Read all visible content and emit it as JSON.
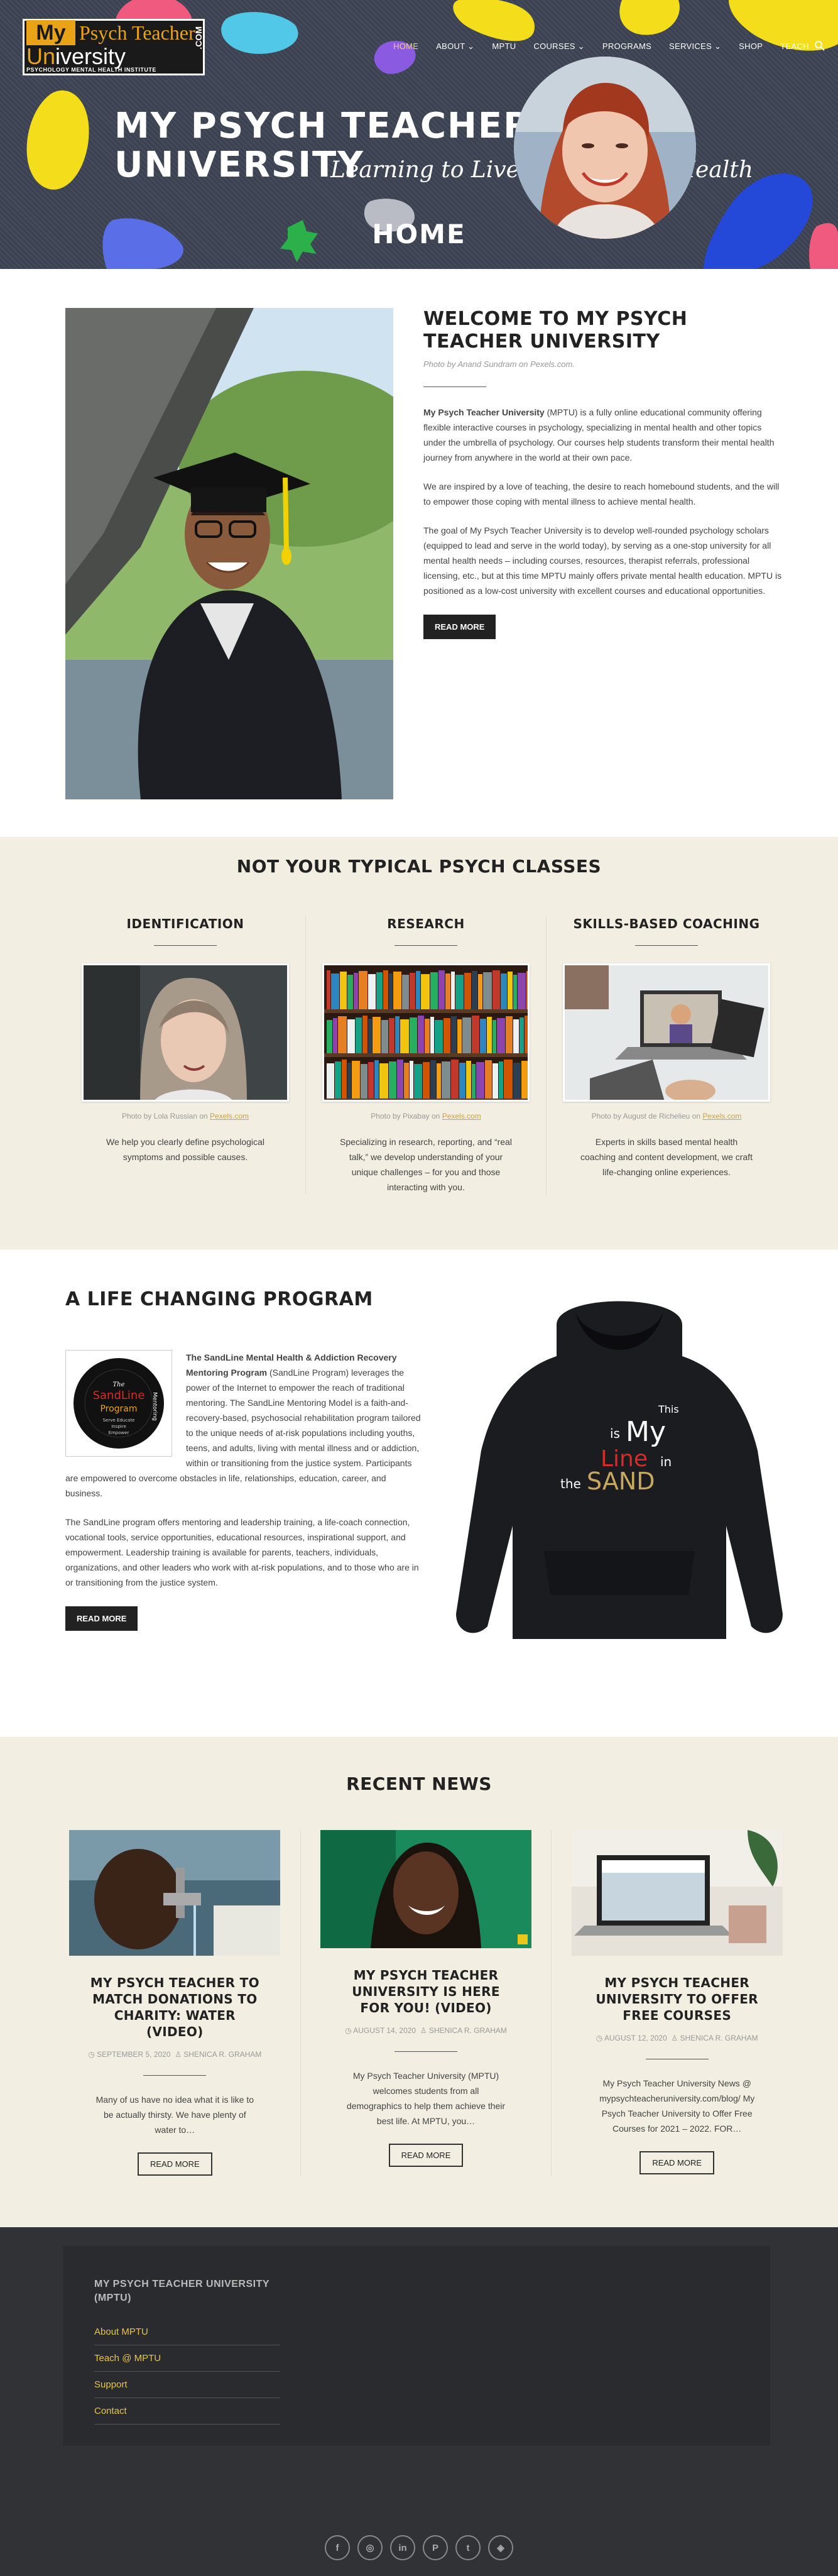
{
  "header": {
    "logo": {
      "my": "My",
      "psych_teacher": "Psych Teacher",
      "university_u": "Un",
      "university_rest": "iversity",
      "subtitle": "PSYCHOLOGY MENTAL HEALTH INSTITUTE",
      "dotcom": ".COM"
    },
    "nav": [
      {
        "label": "HOME",
        "active": true
      },
      {
        "label": "ABOUT ⌄",
        "active": false
      },
      {
        "label": "MPTU",
        "active": false
      },
      {
        "label": "COURSES ⌄",
        "active": false
      },
      {
        "label": "PROGRAMS",
        "active": false
      },
      {
        "label": "SERVICES ⌄",
        "active": false
      },
      {
        "label": "SHOP",
        "active": false
      },
      {
        "label": "TEACH",
        "active": false
      }
    ],
    "hero_title_line1": "MY PSYCH TEACHER",
    "hero_title_line2": "UNIVERSITY",
    "hero_tagline": "Learning to Live With Mental Health",
    "page_title": "HOME"
  },
  "welcome": {
    "title": "WELCOME TO MY PSYCH TEACHER UNIVERSITY",
    "credit_prefix": "Photo by Anand Sundram on ",
    "credit_link": "Pexels.com",
    "credit_suffix": ".",
    "p1_strong": "My Psych Teacher University",
    "p1_rest": " (MPTU) is a fully online educational community offering flexible interactive courses in psychology, specializing in mental health and other topics under the umbrella of psychology. Our courses help students transform their mental health journey from anywhere in the world at their own pace.",
    "p2": "We are inspired by a love of teaching, the desire to reach homebound students, and the will to empower those coping with mental illness to achieve mental health.",
    "p3": "The goal of My Psych Teacher University is to develop well-rounded psychology scholars (equipped to lead and serve in the world today), by serving as a one-stop university for all mental health needs – including courses, resources, therapist referrals, professional licensing, etc., but at this time MPTU mainly offers private mental health education. MPTU is positioned as a low-cost university with excellent courses and educational opportunities.",
    "button": "READ MORE"
  },
  "typical": {
    "title": "NOT YOUR TYPICAL PSYCH CLASSES",
    "columns": [
      {
        "title": "IDENTIFICATION",
        "credit_prefix": "Photo by Lola Russian on ",
        "credit_link": "Pexels.com",
        "text": "We help you clearly define psychological symptoms and possible causes."
      },
      {
        "title": "RESEARCH",
        "credit_prefix": "Photo by Pixabay on ",
        "credit_link": "Pexels.com",
        "text": "Specializing in research, reporting, and “real talk,” we develop understanding of your unique challenges – for you and those interacting with you."
      },
      {
        "title": "SKILLS-BASED COACHING",
        "credit_prefix": "Photo by August de Richelieu on ",
        "credit_link": "Pexels.com",
        "text": "Experts in skills based mental health coaching and content development, we craft life-changing online experiences."
      }
    ]
  },
  "program": {
    "title": "A LIFE CHANGING PROGRAM",
    "logo_the": "The",
    "logo_sandline": "SandLine",
    "logo_program": "Program",
    "logo_tag1": "Serve Educate",
    "logo_tag2": "Inspire",
    "logo_tag3": "Empower",
    "logo_ring": "Mentoring",
    "p1_strong": "The SandLine Mental Health & Addiction Recovery Mentoring Program",
    "p1_rest": " (SandLine Program) leverages the power of the Internet to empower the reach of traditional mentoring. The SandLine Mentoring Model is a faith-and-recovery-based, psychosocial rehabilitation program tailored to the unique needs of at-risk populations including youths, teens, and adults, living with mental illness and or addiction, within or transitioning from the justice system. Participants are empowered to overcome obstacles in life, relationships, education, career, and business.",
    "p2": "The SandLine program offers mentoring and leadership training, a life-coach connection, vocational tools, service opportunities, educational resources, inspirational support, and empowerment. Leadership training is available for parents, teachers, individuals, organizations, and other leaders who work with at-risk populations, and to those who are in or transitioning from the justice system.",
    "button": "READ MORE",
    "hoodie_this": "This",
    "hoodie_is": "is",
    "hoodie_my": "My",
    "hoodie_line": "Line",
    "hoodie_in": "in",
    "hoodie_the": "the",
    "hoodie_sand": "SAND"
  },
  "news": {
    "title": "RECENT NEWS",
    "posts": [
      {
        "title": "MY PSYCH TEACHER TO MATCH DONATIONS TO CHARITY: WATER (VIDEO)",
        "date": "SEPTEMBER 5, 2020",
        "author": "SHENICA R. GRAHAM",
        "excerpt": "Many of us have no idea what it is like to be actually thirsty. We have plenty of water to…",
        "button": "READ MORE"
      },
      {
        "title": "MY PSYCH TEACHER UNIVERSITY IS HERE FOR YOU! (VIDEO)",
        "date": "AUGUST 14, 2020",
        "author": "SHENICA R. GRAHAM",
        "excerpt": "My Psych Teacher University (MPTU) welcomes students from all demographics to help them achieve their best life. At MPTU, you…",
        "button": "READ MORE"
      },
      {
        "title": "MY PSYCH TEACHER UNIVERSITY TO OFFER FREE COURSES",
        "date": "AUGUST 12, 2020",
        "author": "SHENICA R. GRAHAM",
        "excerpt": "My Psych Teacher University News @ mypsychteacheruniversity.com/blog/ My Psych Teacher University to Offer Free Courses for 2021 – 2022. FOR…",
        "button": "READ MORE"
      }
    ]
  },
  "footer": {
    "title": "MY PSYCH TEACHER UNIVERSITY (MPTU)",
    "links": [
      "About MPTU",
      "Teach @ MPTU",
      "Support",
      "Contact"
    ],
    "socials": [
      {
        "icon": "facebook-icon",
        "glyph": "f"
      },
      {
        "icon": "instagram-icon",
        "glyph": "◎"
      },
      {
        "icon": "linkedin-icon",
        "glyph": "in"
      },
      {
        "icon": "pinterest-icon",
        "glyph": "P"
      },
      {
        "icon": "twitter-icon",
        "glyph": "t"
      },
      {
        "icon": "other-social-icon",
        "glyph": "◈"
      }
    ]
  },
  "colors": {
    "accent_gold": "#e8a317",
    "footer_link": "#e8c34a",
    "section_beige": "#f2eee2",
    "footer_bg": "#313236",
    "nav_active": "#f2d76a"
  }
}
